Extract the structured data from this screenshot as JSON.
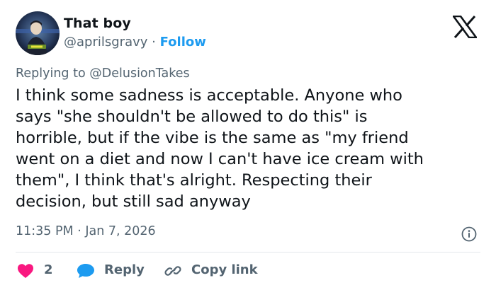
{
  "author": {
    "display_name": "That boy",
    "handle": "@aprilsgravy",
    "separator": "·",
    "follow_label": "Follow"
  },
  "reply_context": {
    "prefix": "Replying to",
    "mention": "@DelusionTakes"
  },
  "tweet": {
    "text_lines": [
      "I think some sadness is acceptable. Anyone who",
      "says \"she shouldn't be allowed to do this\" is",
      "horrible, but if the vibe is the same as \"my friend",
      "went on a diet and now I can't have ice cream with",
      "them\", I think that's alright. Respecting their",
      "decision, but still sad anyway"
    ],
    "timestamp": "11:35 PM · Jan 7, 2026"
  },
  "actions": {
    "like_count": "2",
    "reply_label": "Reply",
    "copy_link_label": "Copy link"
  },
  "icons": {
    "logo": "x-logo-icon",
    "info": "info-icon",
    "like": "heart-icon",
    "reply": "speech-bubble-icon",
    "copy": "link-icon"
  },
  "colors": {
    "text_primary": "#0f1419",
    "text_secondary": "#536471",
    "accent": "#1d9bf0",
    "like": "#f91880",
    "divider": "#e3e8ec"
  }
}
